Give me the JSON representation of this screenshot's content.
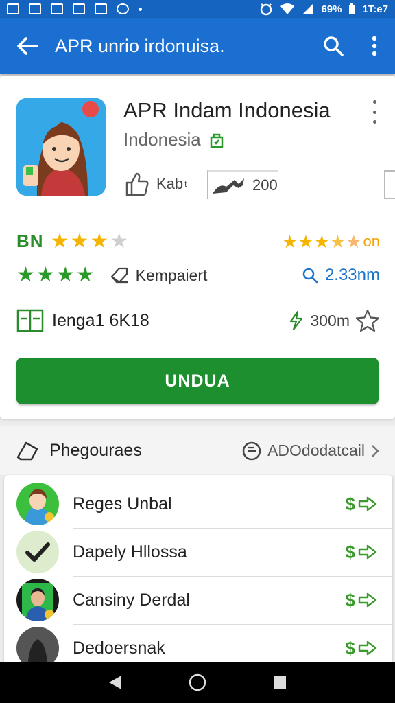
{
  "status_bar": {
    "battery": "69%",
    "time": "1T:e7"
  },
  "app_bar": {
    "title": "APR unrio irdonuisa.",
    "icons": [
      "back-arrow-icon",
      "search-icon",
      "more-vert-icon"
    ],
    "color": "#1a6fd0"
  },
  "app": {
    "name": "APR Indam Indonesia",
    "developer": "Indonesia",
    "meta_likes_label": "Kab",
    "meta_likes_sup": "t",
    "meta_count": "200",
    "rating_code": "BN",
    "rating_stars": 3.5,
    "right_rating_suffix": "on",
    "green_stars": 4,
    "compare_label": "Kempaiert",
    "downloads": "2.33nm",
    "language": "Ienga1 6K18",
    "size": "300m",
    "install_label": "UNDUA",
    "install_color": "#1e8f2e"
  },
  "section": {
    "title": "Phegouraes",
    "link_label": "ADOdodatcail"
  },
  "list": {
    "items": [
      {
        "name": "Reges Unbal",
        "price": "$"
      },
      {
        "name": "Dapely Hllossa",
        "price": "$"
      },
      {
        "name": "Cansiny Derdal",
        "price": "$"
      },
      {
        "name": "Dedoersnak",
        "price": "$"
      }
    ]
  }
}
